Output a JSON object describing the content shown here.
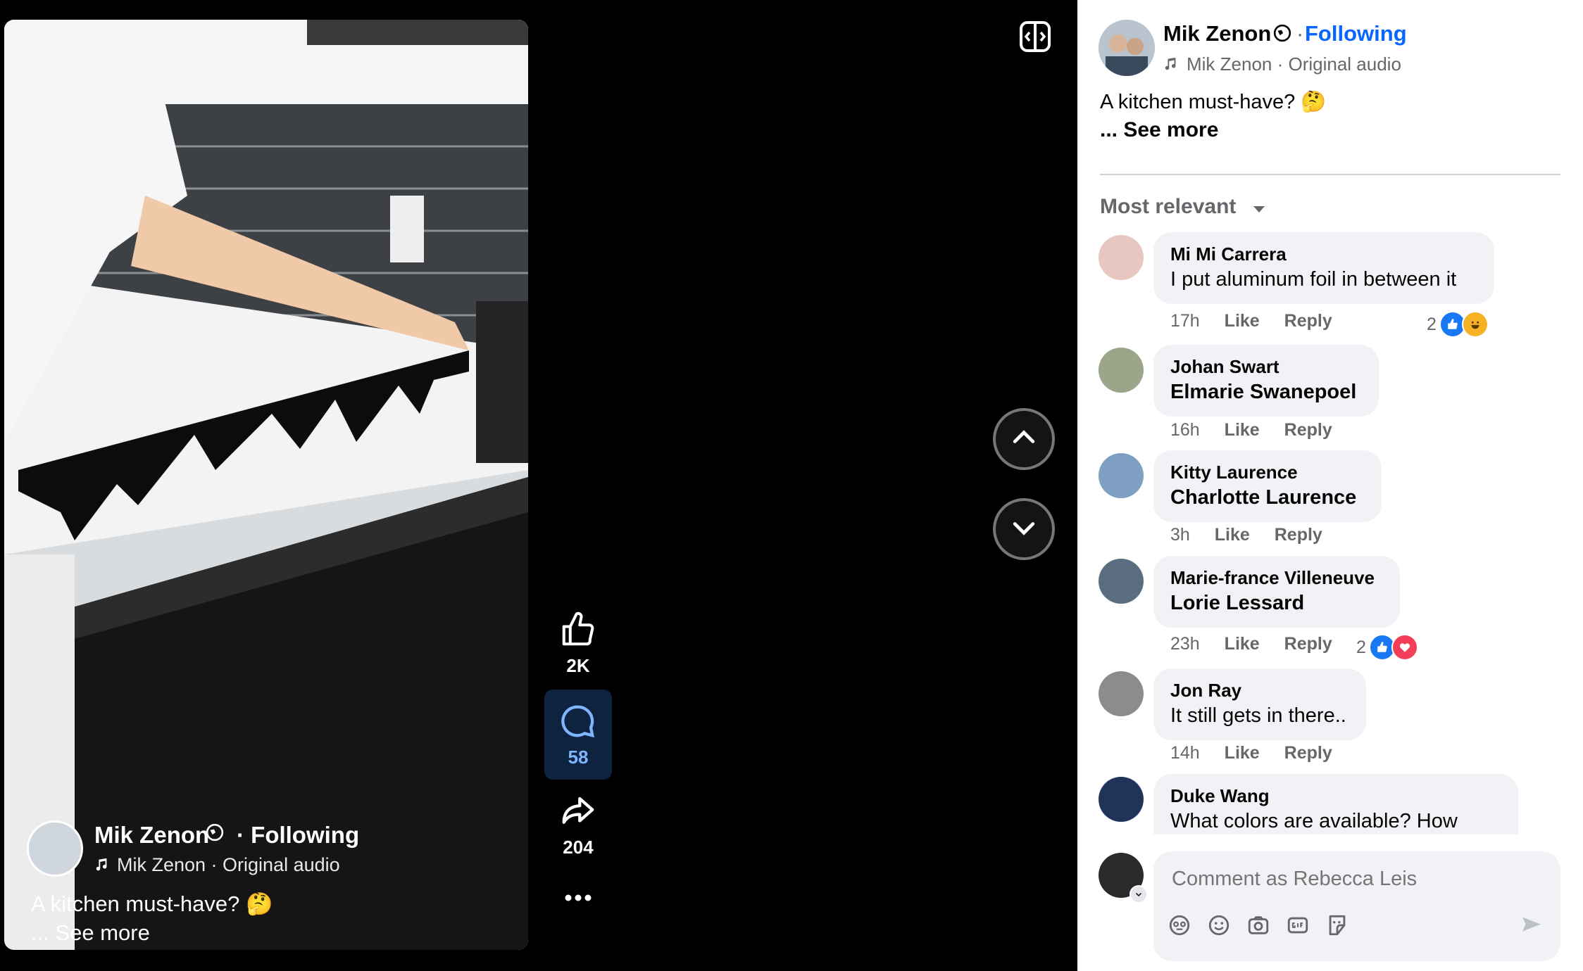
{
  "overlay": {
    "author": "Mik Zenon",
    "following": "· Following",
    "audio": "Mik Zenon · Original audio",
    "caption": "A kitchen must-have? 🤔",
    "see_more": "... See more"
  },
  "actions": {
    "likes": "2K",
    "comments": "58",
    "shares": "204"
  },
  "panel": {
    "author": "Mik Zenon",
    "following": "Following",
    "audio": "Mik Zenon · Original audio",
    "caption": "A kitchen must-have? 🤔",
    "see_more": "... See more",
    "sort_label": "Most relevant"
  },
  "comments": [
    {
      "author": "Mi Mi Carrera",
      "text": "I put aluminum foil in between it",
      "time": "17h",
      "like": "Like",
      "reply": "Reply",
      "reactions": "2"
    },
    {
      "author": "Johan Swart",
      "text": "Elmarie Swanepoel",
      "time": "16h",
      "like": "Like",
      "reply": "Reply",
      "reactions": ""
    },
    {
      "author": "Kitty Laurence",
      "text": "Charlotte Laurence",
      "time": "3h",
      "like": "Like",
      "reply": "Reply",
      "reactions": ""
    },
    {
      "author": "Marie-france Villeneuve",
      "text": "Lorie Lessard",
      "time": "23h",
      "like": "Like",
      "reply": "Reply",
      "reactions": "2"
    },
    {
      "author": "Jon Ray",
      "text": "It still gets in there..",
      "time": "14h",
      "like": "Like",
      "reply": "Reply",
      "reactions": ""
    },
    {
      "author": "Duke Wang",
      "text": "What colors are available? How",
      "time": "",
      "like": "",
      "reply": "",
      "reactions": ""
    }
  ],
  "composer": {
    "placeholder": "Comment as Rebecca Leis"
  },
  "colors": {
    "accent": "#0866ff",
    "panel_bg": "#ffffff",
    "bubble_bg": "#f0f2f5",
    "muted_text": "#65676b"
  }
}
